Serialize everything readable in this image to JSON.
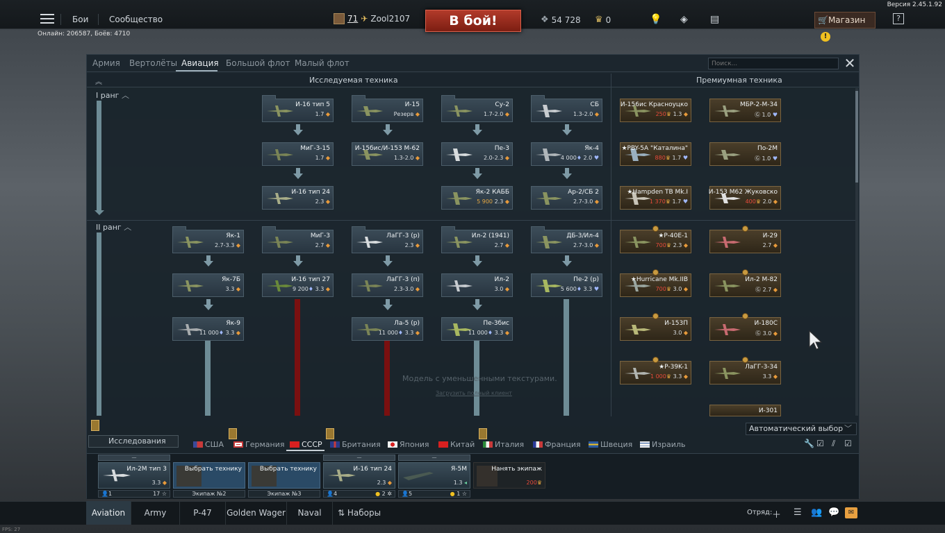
{
  "version": "Версия 2.45.1.92",
  "online": "Онлайн: 206587, Боёв: 4710",
  "fps": "FPS: 27",
  "menu": {
    "battles": "Бои",
    "community": "Сообщество"
  },
  "player": {
    "level": "71",
    "name": "Zool2107"
  },
  "battle_button": "В бой!",
  "resources": {
    "silver_lions": "54 728",
    "golden_eagles": "0"
  },
  "shop": {
    "label": "Магазин",
    "warning": "!"
  },
  "help": "?",
  "vehicle_types": [
    "Армия",
    "Вертолёты",
    "Авиация",
    "Большой флот",
    "Малый флот"
  ],
  "active_type": "Авиация",
  "search_placeholder": "Поиск...",
  "headers": {
    "research": "Исследуемая техника",
    "premium": "Премиумная техника"
  },
  "ranks": {
    "r1": "I ранг",
    "r2": "II ранг"
  },
  "tree": {
    "i16_5": {
      "name": "И-16 тип 5",
      "br": "1.7"
    },
    "i15": {
      "name": "И-15",
      "br": "Резерв"
    },
    "su2": {
      "name": "Су-2",
      "br": "1.7-2.0"
    },
    "sb": {
      "name": "СБ",
      "br": "1.3-2.0"
    },
    "mig315": {
      "name": "МиГ-3-15",
      "br": "1.7"
    },
    "i153": {
      "name": "И-15бис/И-153 М-62",
      "br": "1.3-2.0"
    },
    "pe3": {
      "name": "Пе-3",
      "br": "2.0-2.3"
    },
    "yak4": {
      "name": "Як-4",
      "cost": "4 000",
      "br": "2.0"
    },
    "i16_24": {
      "name": "И-16 тип 24",
      "br": "2.3"
    },
    "yak2": {
      "name": "Як-2 КАББ",
      "cost": "5 900",
      "br": "2.3"
    },
    "ar2": {
      "name": "Ар-2/СБ 2",
      "br": "2.7-3.0"
    },
    "yak1": {
      "name": "Як-1",
      "br": "2.7-3.3"
    },
    "mig3": {
      "name": "МиГ-3",
      "br": "2.7"
    },
    "lagg3p": {
      "name": "ЛаГГ-3 (р)",
      "br": "2.3"
    },
    "il2_41": {
      "name": "Ил-2 (1941)",
      "br": "2.7"
    },
    "db3": {
      "name": "ДБ-3/Ил-4",
      "br": "2.7-3.0"
    },
    "yak7b": {
      "name": "Як-7Б",
      "br": "3.3"
    },
    "i16_27": {
      "name": "И-16 тип 27",
      "cost": "9 200",
      "br": "3.3"
    },
    "lagg3n": {
      "name": "ЛаГГ-3 (п)",
      "br": "2.3-3.0"
    },
    "il2": {
      "name": "Ил-2",
      "br": "3.0"
    },
    "pe2": {
      "name": "Пе-2 (р)",
      "cost": "5 600",
      "br": "3.3"
    },
    "yak9": {
      "name": "Як-9",
      "cost": "11 000",
      "br": "3.3"
    },
    "la5": {
      "name": "Ла-5 (р)",
      "cost": "11 000",
      "br": "3.3"
    },
    "pe3bis": {
      "name": "Пе-3бис",
      "cost": "11 000",
      "br": "3.3"
    }
  },
  "premium": {
    "p1": {
      "name": "И-156ис Красноуцко",
      "price": "250",
      "br": "1.3"
    },
    "p2": {
      "name": "МБР-2-М-34",
      "br": "1.0"
    },
    "p3": {
      "name": "★PBY-5A \"Каталина\"",
      "price": "880",
      "br": "1.7"
    },
    "p4": {
      "name": "По-2М",
      "br": "1.0"
    },
    "p5": {
      "name": "★Hampden TB Mk.I",
      "price": "1 370",
      "br": "1.7"
    },
    "p6": {
      "name": "И-153 М62 Жуковско",
      "price": "400",
      "br": "2.0"
    },
    "p7": {
      "name": "★P-40E-1",
      "price": "700",
      "br": "2.3"
    },
    "p8": {
      "name": "И-29",
      "br": "2.7"
    },
    "p9": {
      "name": "★Hurricane Mk.IIB",
      "price": "700",
      "br": "3.0"
    },
    "p10": {
      "name": "Ил-2 М-82",
      "br": "2.7"
    },
    "p11": {
      "name": "И-153П",
      "br": "3.0"
    },
    "p12": {
      "name": "И-180С",
      "br": "3.0"
    },
    "p13": {
      "name": "★P-39K-1",
      "price": "1 000",
      "br": "3.3"
    },
    "p14": {
      "name": "ЛаГГ-3-34",
      "br": "3.3"
    },
    "p15": {
      "name": "И-301"
    }
  },
  "watermark": {
    "line1": "Модель с уменьшенными текстурами.",
    "line2": "Загрузить полный клиент"
  },
  "auto_select": "Автоматический выбор",
  "research_label": "Исследования",
  "nations": [
    "США",
    "Германия",
    "СССР",
    "Британия",
    "Япония",
    "Китай",
    "Италия",
    "Франция",
    "Швеция",
    "Израиль"
  ],
  "active_nation": "СССР",
  "slots": [
    {
      "name": "Ил-2М тип 3",
      "br": "3.3",
      "num": "1",
      "stat": "17",
      "top": "—"
    },
    {
      "name": "Выбрать технику",
      "crew": "Экипаж №2"
    },
    {
      "name": "Выбрать технику",
      "crew": "Экипаж №3"
    },
    {
      "name": "И-16 тип 24",
      "br": "2.3",
      "num": "4",
      "stat": "2",
      "top": "—"
    },
    {
      "name": "Я-5М",
      "br": "1.3",
      "num": "5",
      "stat": "1",
      "top": "—"
    },
    {
      "name": "Нанять экипаж",
      "price": "200"
    }
  ],
  "presets": [
    "Aviation",
    "Army",
    "P-47",
    "Golden Wager",
    "Naval",
    "Наборы"
  ],
  "squad_label": "Отряд:",
  "colors": {
    "accent_red": "#b23a2a",
    "premium_gold": "#c89a40",
    "research_line": "#6e8c96",
    "locked_line": "#7a1010"
  }
}
